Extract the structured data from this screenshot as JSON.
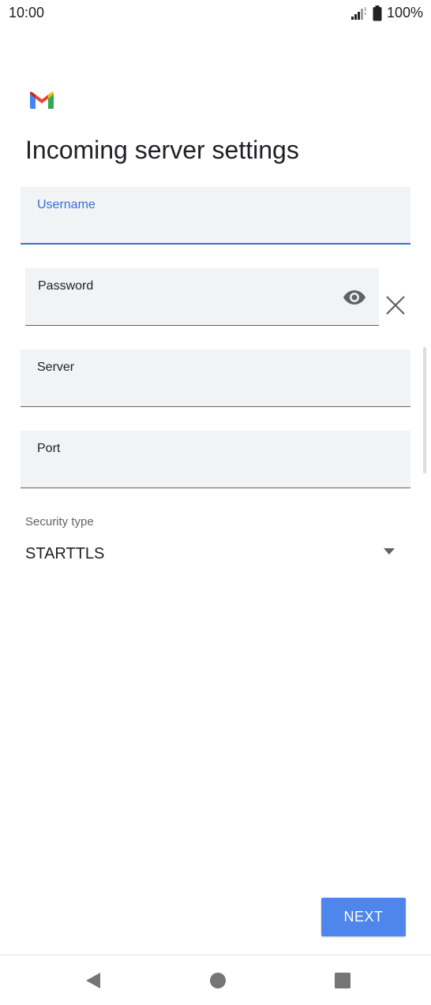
{
  "status_bar": {
    "time": "10:00",
    "battery": "100%",
    "signal_icon": "signal-icon",
    "battery_icon": "battery-icon"
  },
  "app": {
    "logo": "gmail-logo",
    "title": "Incoming server settings"
  },
  "form": {
    "username": {
      "label": "Username",
      "value": "",
      "focused": true
    },
    "password": {
      "label": "Password",
      "value": ""
    },
    "server": {
      "label": "Server",
      "value": ""
    },
    "port": {
      "label": "Port",
      "value": ""
    },
    "security": {
      "label": "Security type",
      "selected": "STARTTLS"
    }
  },
  "actions": {
    "next_label": "NEXT"
  },
  "colors": {
    "accent": "#3c6fd1",
    "button": "#4f86ec",
    "field_bg": "#f1f3f4"
  },
  "icons": {
    "eye": "eye-icon",
    "clear": "close-icon",
    "dropdown": "dropdown-arrow-icon",
    "nav_back": "back-icon",
    "nav_home": "home-icon",
    "nav_recents": "recents-icon"
  }
}
